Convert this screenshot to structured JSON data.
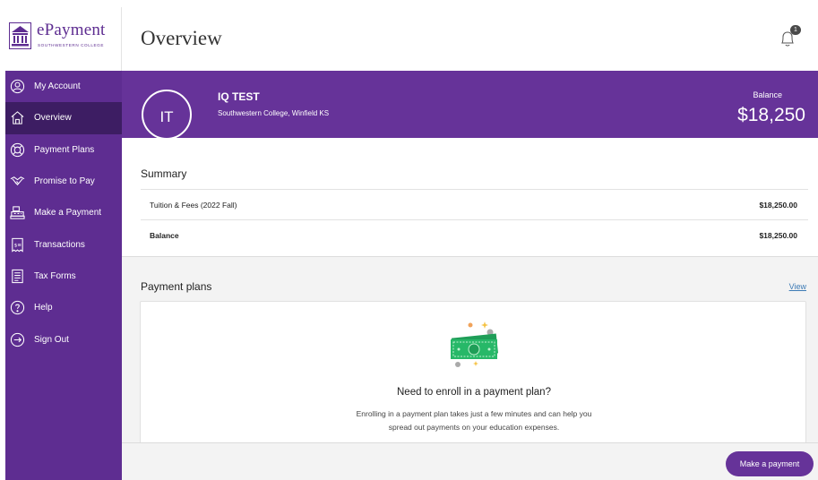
{
  "brand": {
    "name": "ePayment",
    "subtitle": "SOUTHWESTERN COLLEGE",
    "logo_icon": "college-building-icon",
    "color": "#5e2d91"
  },
  "sidebar": {
    "items": [
      {
        "label": "My Account",
        "icon": "user-circle-icon",
        "active": false
      },
      {
        "label": "Overview",
        "icon": "home-icon",
        "active": true
      },
      {
        "label": "Payment Plans",
        "icon": "lifebuoy-icon",
        "active": false
      },
      {
        "label": "Promise to Pay",
        "icon": "handshake-icon",
        "active": false
      },
      {
        "label": "Make a Payment",
        "icon": "cash-register-icon",
        "active": false
      },
      {
        "label": "Transactions",
        "icon": "receipt-icon",
        "active": false
      },
      {
        "label": "Tax Forms",
        "icon": "document-icon",
        "active": false
      },
      {
        "label": "Help",
        "icon": "help-circle-icon",
        "active": false
      },
      {
        "label": "Sign Out",
        "icon": "sign-out-icon",
        "active": false
      }
    ]
  },
  "header": {
    "title": "Overview",
    "notification_icon": "bell-icon",
    "notification_count": "1"
  },
  "profile": {
    "initials": "IT",
    "name": "IQ TEST",
    "school": "Southwestern College, Winfield KS",
    "balance_label": "Balance",
    "balance_value": "$18,250"
  },
  "summary": {
    "title": "Summary",
    "rows": [
      {
        "label": "Tuition & Fees (2022 Fall)",
        "amount": "$18,250.00"
      },
      {
        "label": "Balance",
        "amount": "$18,250.00"
      }
    ]
  },
  "payment_plans": {
    "title": "Payment plans",
    "link": "View",
    "illustration_icon": "money-bills-icon",
    "heading": "Need to enroll in a payment plan?",
    "text_line1": "Enrolling in a payment plan takes just a few minutes and can help you",
    "text_line2": "spread out payments on your education expenses."
  },
  "footer": {
    "button_label": "Make a payment"
  },
  "colors": {
    "accent": "#663399",
    "sidebar": "#5e2d91",
    "sidebar_active": "#3d1d63",
    "link": "#3d7bb5"
  }
}
